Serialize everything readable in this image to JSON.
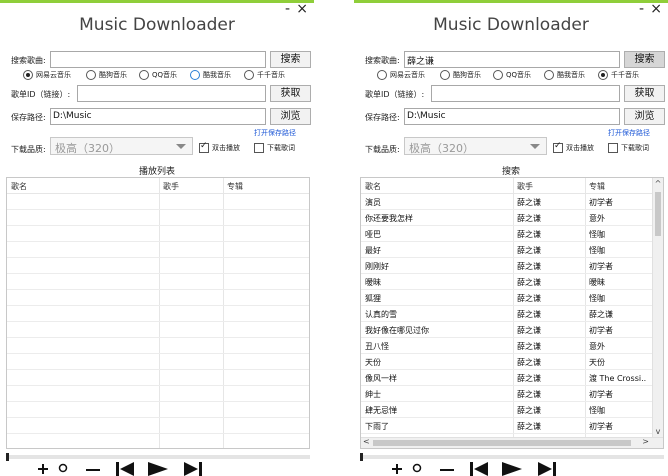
{
  "app_title": "Music Downloader",
  "window_controls": {
    "minimize": "-",
    "close": "×"
  },
  "labels": {
    "search_song": "搜索歌曲:",
    "playlist_id": "歌单ID（链接）:",
    "save_path": "保存路径:",
    "quality": "下载品质:",
    "open_save_path": "打开保存路径",
    "double_click_play": "双击播放",
    "download_lyrics": "下载歌词"
  },
  "buttons": {
    "search": "搜索",
    "fetch": "获取",
    "browse": "浏览"
  },
  "sources": [
    "网易云音乐",
    "酷狗音乐",
    "QQ音乐",
    "酷我音乐",
    "千千音乐"
  ],
  "quality_value": "极高（320）",
  "left": {
    "search_value": "",
    "source_selected": "网易云音乐",
    "playlist_value": "",
    "save_path_value": "D:\\Music",
    "double_click_play": true,
    "download_lyrics": false,
    "list_title": "播放列表",
    "columns": [
      "歌名",
      "歌手",
      "专辑"
    ],
    "rows": []
  },
  "right": {
    "search_value": "薛之谦",
    "source_selected": "千千音乐",
    "playlist_value": "",
    "save_path_value": "D:\\Music",
    "double_click_play": true,
    "download_lyrics": false,
    "list_title": "搜索",
    "columns": [
      "歌名",
      "歌手",
      "专辑"
    ],
    "rows": [
      [
        "演员",
        "薛之谦",
        "初学者"
      ],
      [
        "你还要我怎样",
        "薛之谦",
        "意外"
      ],
      [
        "哑巴",
        "薛之谦",
        "怪咖"
      ],
      [
        "最好",
        "薛之谦",
        "怪咖"
      ],
      [
        "刚刚好",
        "薛之谦",
        "初学者"
      ],
      [
        "暧昧",
        "薛之谦",
        "暧昧"
      ],
      [
        "狐狸",
        "薛之谦",
        "怪咖"
      ],
      [
        "认真的雪",
        "薛之谦",
        "薛之谦"
      ],
      [
        "我好像在哪见过你",
        "薛之谦",
        "初学者"
      ],
      [
        "丑八怪",
        "薛之谦",
        "意外"
      ],
      [
        "天份",
        "薛之谦",
        "天份"
      ],
      [
        "像风一样",
        "薛之谦",
        "渡 The Crossi.."
      ],
      [
        "绅士",
        "薛之谦",
        "初学者"
      ],
      [
        "肆无忌惮",
        "薛之谦",
        "怪咖"
      ],
      [
        "下雨了",
        "薛之谦",
        "初学者"
      ]
    ]
  },
  "playback": {
    "progress_fraction": 0.0
  },
  "icons": [
    "minimize-icon",
    "close-icon",
    "add-icon",
    "lyrics-icon",
    "menu-icon",
    "previous-icon",
    "play-icon",
    "next-icon"
  ],
  "colors": {
    "accent_green": "#8fce3a",
    "link_blue": "#1a55d6"
  }
}
